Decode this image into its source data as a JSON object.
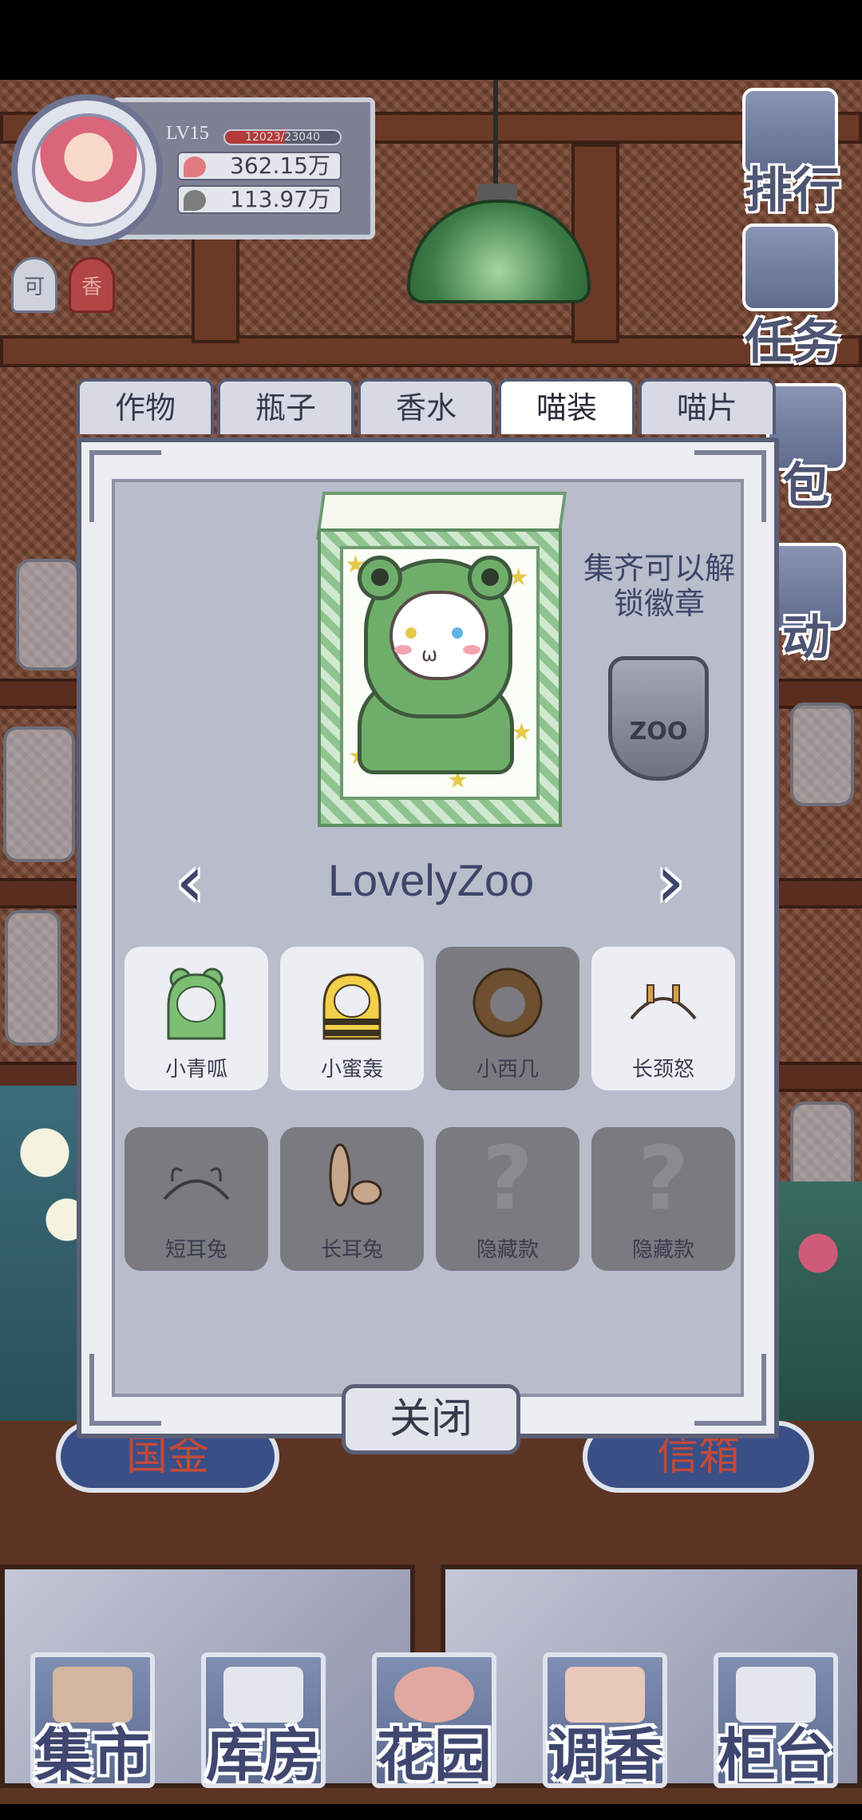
{
  "hud": {
    "level": "LV15",
    "xp_text": "12023/23040",
    "xp_progress": 0.522,
    "currency_red": "362.15万",
    "currency_green": "113.97万",
    "badge_1": "可",
    "badge_2": "香"
  },
  "side_buttons": [
    "排行",
    "任务",
    "包",
    "动"
  ],
  "tabs": [
    {
      "label": "作物",
      "active": false
    },
    {
      "label": "瓶子",
      "active": false
    },
    {
      "label": "香水",
      "active": false
    },
    {
      "label": "喵装",
      "active": true
    },
    {
      "label": "喵片",
      "active": false
    }
  ],
  "featured": {
    "hint": "集齐可以解锁徽章",
    "badge_text": "ZOO",
    "set_name": "LovelyZoo"
  },
  "items": [
    {
      "label": "小青呱",
      "owned": true
    },
    {
      "label": "小蜜轰",
      "owned": true
    },
    {
      "label": "小西几",
      "owned": false
    },
    {
      "label": "长颈怒",
      "owned": true
    },
    {
      "label": "短耳兔",
      "owned": false
    },
    {
      "label": "长耳兔",
      "owned": false
    },
    {
      "label": "隐藏款",
      "owned": false
    },
    {
      "label": "隐藏款",
      "owned": false
    }
  ],
  "close_label": "关闭",
  "under_signs": [
    "国金",
    "信箱"
  ],
  "bottom_nav": [
    "集市",
    "库房",
    "花园",
    "调香",
    "柜台"
  ]
}
